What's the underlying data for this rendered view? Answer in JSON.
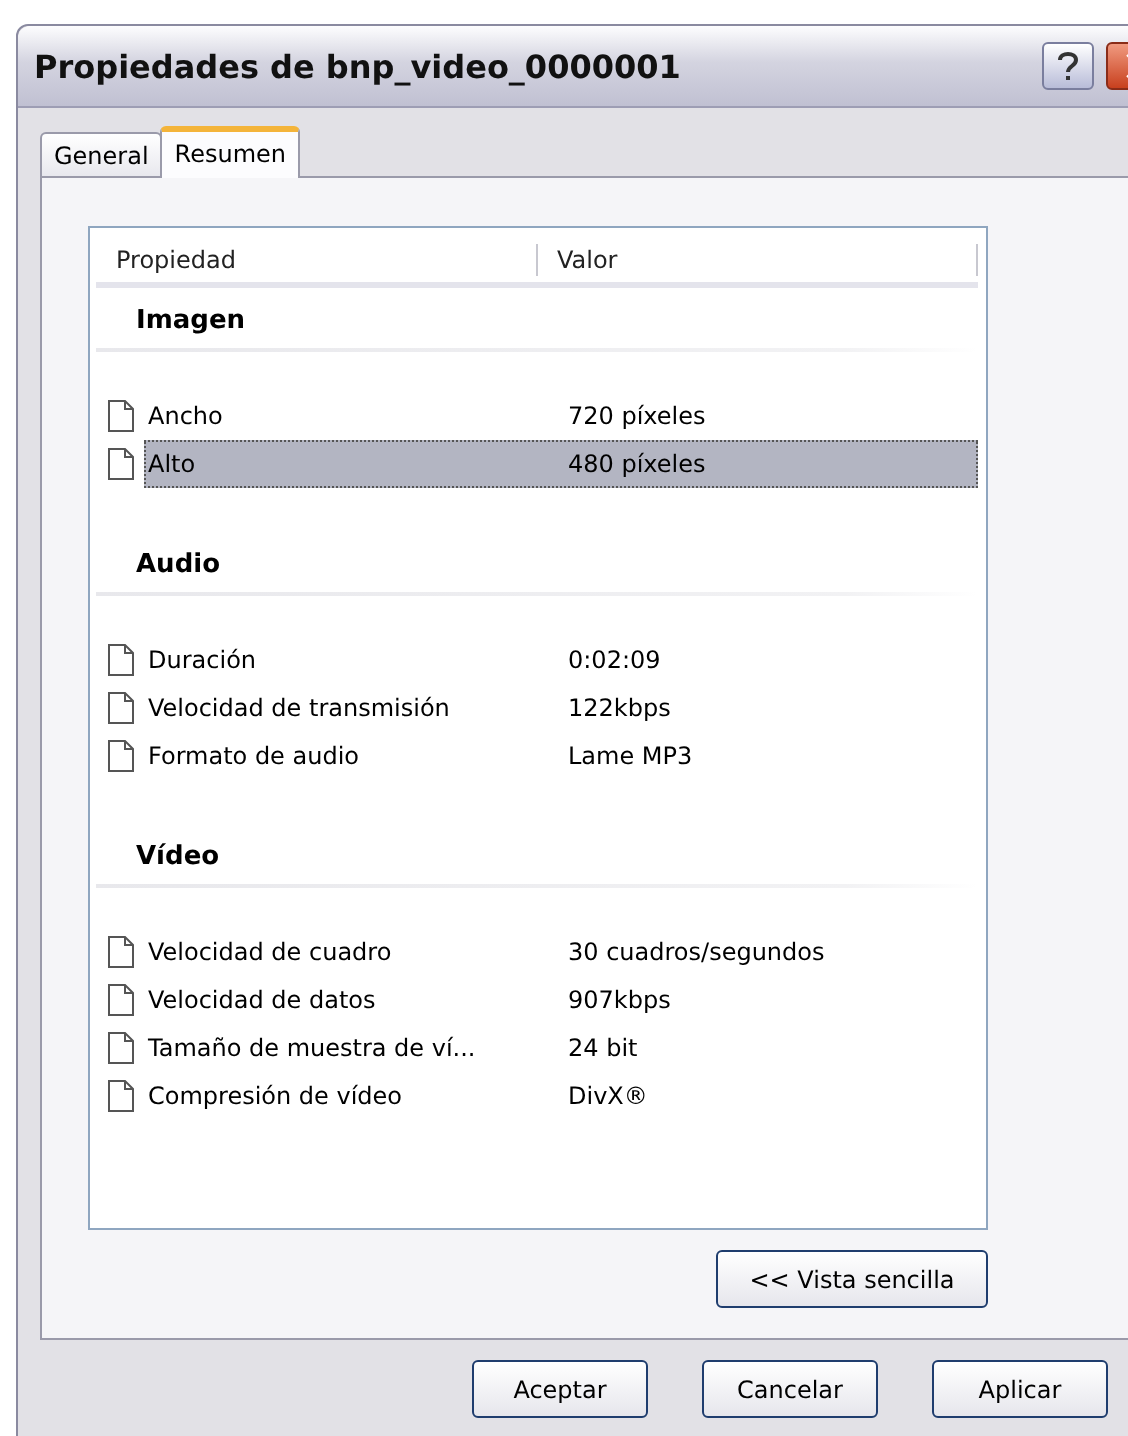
{
  "window": {
    "title": "Propiedades de bnp_video_0000001"
  },
  "tabs": [
    {
      "label": "General",
      "selected": false
    },
    {
      "label": "Resumen",
      "selected": true
    }
  ],
  "table": {
    "columns": [
      "Propiedad",
      "Valor"
    ],
    "sections": [
      {
        "heading": "Imagen",
        "rows": [
          {
            "name": "Ancho",
            "value": "720 píxeles",
            "selected": false
          },
          {
            "name": "Alto",
            "value": "480 píxeles",
            "selected": true
          }
        ]
      },
      {
        "heading": "Audio",
        "rows": [
          {
            "name": "Duración",
            "value": "0:02:09",
            "selected": false
          },
          {
            "name": "Velocidad de transmisión",
            "value": "122kbps",
            "selected": false
          },
          {
            "name": "Formato de audio",
            "value": "Lame MP3",
            "selected": false
          }
        ]
      },
      {
        "heading": "Vídeo",
        "rows": [
          {
            "name": "Velocidad de cuadro",
            "value": "30 cuadros/segundos",
            "selected": false
          },
          {
            "name": "Velocidad de datos",
            "value": "907kbps",
            "selected": false
          },
          {
            "name": "Tamaño de muestra de ví...",
            "value": "24 bit",
            "selected": false
          },
          {
            "name": "Compresión de vídeo",
            "value": "DivX®",
            "selected": false
          }
        ]
      }
    ]
  },
  "view_button": "<< Vista sencilla",
  "buttons": [
    "Aceptar",
    "Cancelar",
    "Aplicar"
  ]
}
